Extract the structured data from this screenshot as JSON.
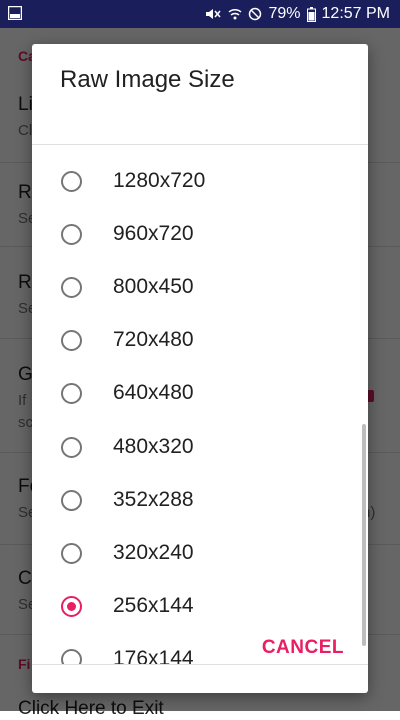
{
  "statusbar": {
    "battery": "79%",
    "time": "12:57 PM",
    "icons": [
      "gallery-icon",
      "mute-icon",
      "wifi-icon",
      "do-not-disturb-icon",
      "battery-icon"
    ]
  },
  "background": {
    "category_top": "Ca",
    "items": [
      {
        "title": "Li",
        "sub": "Cl"
      },
      {
        "title": "R",
        "sub": "Se"
      },
      {
        "title": "R",
        "sub": "Se"
      },
      {
        "title": "G",
        "sub": "If",
        "sub2": "sc"
      },
      {
        "title": "Fo",
        "sub": "Se",
        "sub_right": "n)"
      },
      {
        "title": "C",
        "sub": "Se"
      }
    ],
    "category_bottom": "Fi",
    "last_item": "Click Here to Exit"
  },
  "dialog": {
    "title": "Raw Image Size",
    "options": [
      {
        "label": "1280x720",
        "checked": false
      },
      {
        "label": "960x720",
        "checked": false
      },
      {
        "label": "800x450",
        "checked": false
      },
      {
        "label": "720x480",
        "checked": false
      },
      {
        "label": "640x480",
        "checked": false
      },
      {
        "label": "480x320",
        "checked": false
      },
      {
        "label": "352x288",
        "checked": false
      },
      {
        "label": "320x240",
        "checked": false
      },
      {
        "label": "256x144",
        "checked": true
      },
      {
        "label": "176x144",
        "checked": false
      }
    ],
    "cancel_label": "CANCEL"
  },
  "colors": {
    "accent": "#e91e63",
    "statusbar": "#1a1f5c"
  }
}
